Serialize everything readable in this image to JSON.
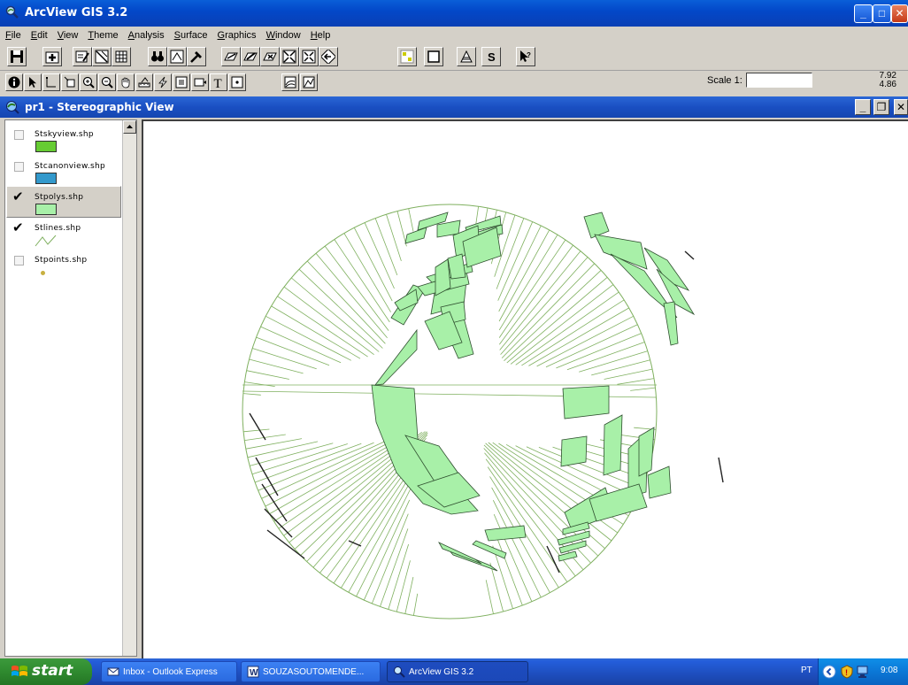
{
  "app": {
    "title": "ArcView GIS 3.2"
  },
  "menu": [
    {
      "label": "File",
      "key": "F",
      "rest": "ile"
    },
    {
      "label": "Edit",
      "key": "E",
      "rest": "dit"
    },
    {
      "label": "View",
      "key": "V",
      "rest": "iew"
    },
    {
      "label": "Theme",
      "key": "T",
      "rest": "heme"
    },
    {
      "label": "Analysis",
      "key": "A",
      "rest": "nalysis"
    },
    {
      "label": "Surface",
      "key": "S",
      "rest": "urface"
    },
    {
      "label": "Graphics",
      "key": "G",
      "rest": "raphics"
    },
    {
      "label": "Window",
      "key": "W",
      "rest": "indow"
    },
    {
      "label": "Help",
      "key": "H",
      "rest": "elp"
    }
  ],
  "toolbar2": {
    "scale_label": "Scale 1:",
    "scale_value": "",
    "coord_x": "7.92",
    "coord_y": "4.86"
  },
  "view": {
    "title": "pr1 - Stereographic View"
  },
  "layers": [
    {
      "name": "Stskyview.shp",
      "checked": false,
      "symbol": "fill",
      "color": "#66cc33"
    },
    {
      "name": "Stcanonview.shp",
      "checked": false,
      "symbol": "fill",
      "color": "#3399cc"
    },
    {
      "name": "Stpolys.shp",
      "checked": true,
      "symbol": "fill",
      "color": "#a8f0a8"
    },
    {
      "name": "Stlines.shp",
      "checked": true,
      "symbol": "line",
      "color": "#7fb05f"
    },
    {
      "name": "Stpoints.shp",
      "checked": false,
      "symbol": "point",
      "color": "#c8b040"
    }
  ],
  "colors": {
    "polygon_fill": "#a8f0a8",
    "line_stroke": "#7fb05f",
    "dark_line": "#222222"
  },
  "check_glyph": "✔",
  "taskbar": {
    "start_label": "start",
    "tasks": [
      {
        "label": "Inbox - Outlook Express",
        "icon": "outlook-icon"
      },
      {
        "label": "SOUZASOUTOMENDE...",
        "icon": "word-icon"
      },
      {
        "label": "ArcView GIS 3.2",
        "icon": "arcview-icon"
      }
    ],
    "language": "PT",
    "clock": "9:08"
  },
  "window_buttons": {
    "minimize": "_",
    "maximize": "□",
    "close": "✕",
    "restore": "❐"
  }
}
